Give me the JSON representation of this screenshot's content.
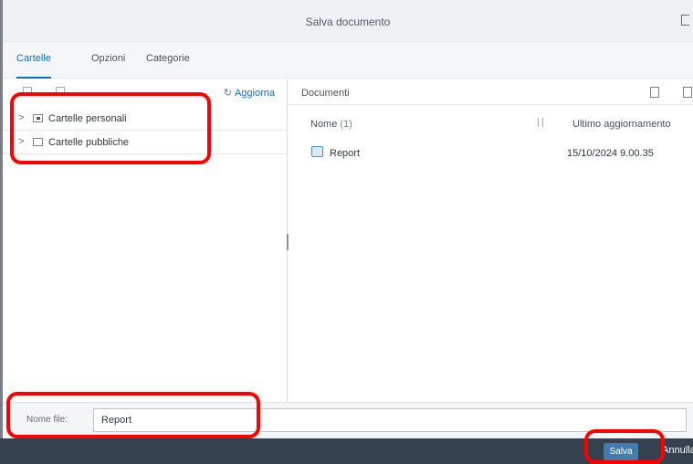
{
  "dialog": {
    "title": "Salva documento"
  },
  "tabs": [
    {
      "label": "Cartelle",
      "active": true
    },
    {
      "label": "Opzioni",
      "active": false
    },
    {
      "label": "Categorie",
      "active": false
    }
  ],
  "folders_pane": {
    "refresh_label": "Aggiorna",
    "items": [
      {
        "label": "Cartelle personali",
        "icon": "folder-personal-icon"
      },
      {
        "label": "Cartelle pubbliche",
        "icon": "folder-public-icon"
      }
    ]
  },
  "documents_pane": {
    "title": "Documenti",
    "columns": {
      "name": "Nome",
      "count": "(1)",
      "date": "Ultimo aggiornamento"
    },
    "rows": [
      {
        "name": "Report",
        "date": "15/10/2024 9.00.35",
        "icon": "report-doc-icon"
      }
    ]
  },
  "filename": {
    "label": "Nome file:",
    "value": "Report"
  },
  "footer": {
    "save_label": "Salva",
    "cancel_label": "Annulla"
  },
  "colors": {
    "accent": "#0a6ed1",
    "footer_bg": "#35414e",
    "save_button": "#427cac",
    "highlight": "#ff0000"
  }
}
